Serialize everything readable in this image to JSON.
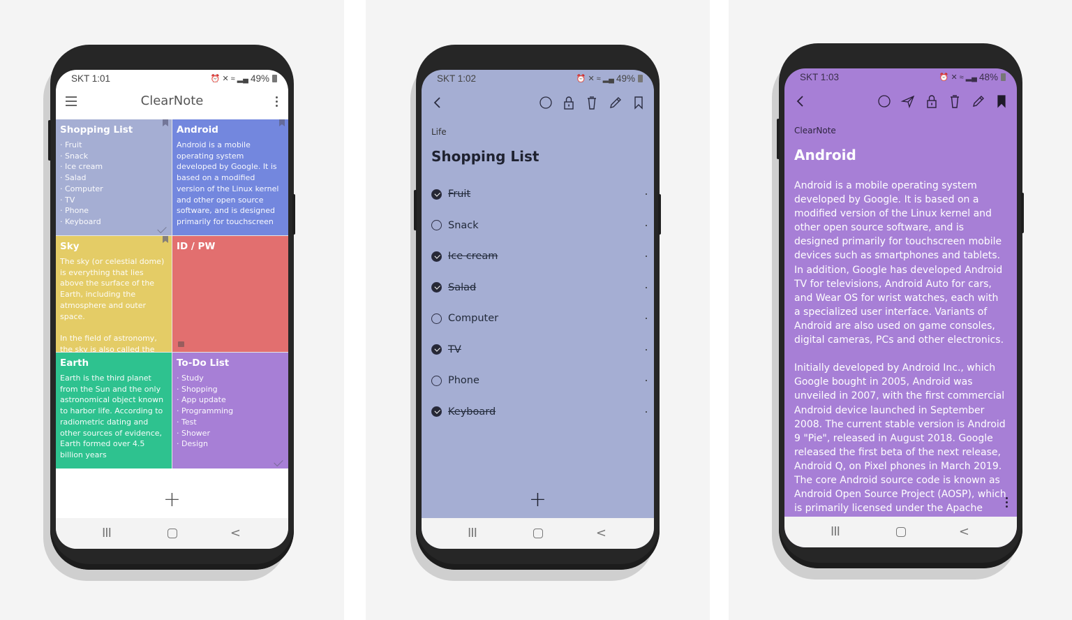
{
  "screens": [
    {
      "status": {
        "carrier_time": "SKT 1:01",
        "battery": "49%",
        "status_icons": [
          "alarm-icon",
          "mute-icon",
          "wifi-icon",
          "signal-icon",
          "battery-icon"
        ]
      },
      "app_title": "ClearNote",
      "notes": [
        {
          "title": "Shopping List",
          "body": "· Fruit\n· Snack\n· Ice cream\n· Salad\n· Computer\n· TV\n· Phone\n· Keyboard",
          "color": "#a5aed3",
          "bookmarked": true,
          "checked": true
        },
        {
          "title": "Android",
          "body": "Android is a mobile operating system developed by Google. It is based on a modified version of the Linux kernel and other open source software, and is designed primarily for touchscreen",
          "color": "#7387de",
          "bookmarked": true,
          "checked": false
        },
        {
          "title": "Sky",
          "body": "The sky (or celestial dome) is everything that lies above the surface of the Earth, including the atmosphere and outer space.\n\nIn the field of astronomy, the sky is also called the",
          "color": "#e4cc66",
          "bookmarked": true,
          "checked": false
        },
        {
          "title": "ID / PW",
          "body": "",
          "color": "#e26f6f",
          "bookmarked": false,
          "locked": true
        },
        {
          "title": "Earth",
          "body": "Earth is the third planet from the Sun and the only astronomical object known to harbor life. According to radiometric dating and other sources of evidence, Earth formed over 4.5 billion years",
          "color": "#2ec28f",
          "bookmarked": false,
          "checked": false
        },
        {
          "title": "To-Do List",
          "body": "· Study\n· Shopping\n· App update\n· Programming\n· Test\n· Shower\n· Design",
          "color": "#a77fd6",
          "bookmarked": false,
          "checked": true
        }
      ],
      "add_label": "+"
    },
    {
      "status": {
        "carrier_time": "SKT 1:02",
        "battery": "49%"
      },
      "category": "Life",
      "title": "Shopping List",
      "bg": "#a5aed3",
      "toolbar_icons": [
        "back-icon",
        "circle-icon",
        "lock-icon",
        "trash-icon",
        "pencil-icon",
        "bookmark-icon"
      ],
      "items": [
        {
          "text": "Fruit",
          "done": true
        },
        {
          "text": "Snack",
          "done": false
        },
        {
          "text": "Ice cream",
          "done": true
        },
        {
          "text": "Salad",
          "done": true
        },
        {
          "text": "Computer",
          "done": false
        },
        {
          "text": "TV",
          "done": true
        },
        {
          "text": "Phone",
          "done": false
        },
        {
          "text": "Keyboard",
          "done": true
        }
      ],
      "add_label": "+"
    },
    {
      "status": {
        "carrier_time": "SKT 1:03",
        "battery": "48%"
      },
      "category": "ClearNote",
      "title": "Android",
      "bg": "#a77fd6",
      "toolbar_icons": [
        "back-icon",
        "circle-icon",
        "send-icon",
        "lock-icon",
        "trash-icon",
        "pencil-icon",
        "bookmark-filled-icon"
      ],
      "body": "Android is a mobile operating system developed by Google. It is based on a modified version of the Linux kernel and other open source software, and is designed primarily for touchscreen mobile devices such as smartphones and tablets. In addition, Google has developed Android TV for televisions, Android Auto for cars, and Wear OS for wrist watches, each with a specialized user interface. Variants of Android are also used on game consoles, digital cameras, PCs and other electronics.\n\nInitially developed by Android Inc., which Google bought in 2005, Android was unveiled in 2007, with the first commercial Android device launched in September 2008. The current stable version is Android 9 \"Pie\", released in August 2018. Google released the first beta of the next release, Android Q, on Pixel phones in March 2019. The core Android source code is known as Android Open Source Project (AOSP), which is primarily licensed under the Apache"
    }
  ]
}
